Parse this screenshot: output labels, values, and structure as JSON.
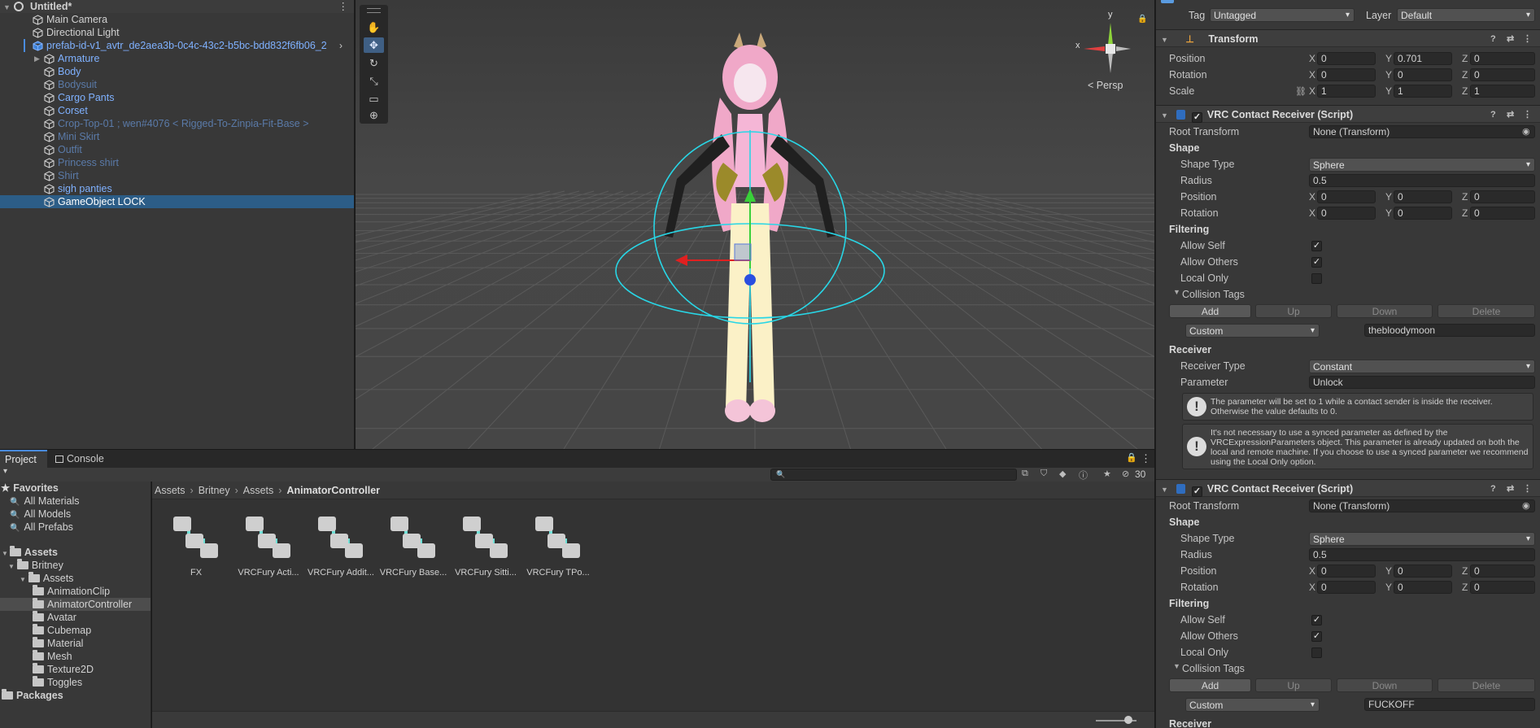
{
  "hierarchy": {
    "scene_name": "Untitled*",
    "items": [
      {
        "label": "Main Camera",
        "style": "normal"
      },
      {
        "label": "Directional Light",
        "style": "normal"
      },
      {
        "label": "prefab-id-v1_avtr_de2aea3b-0c4c-43c2-b5bc-bdd832f6fb06_2",
        "style": "prefab"
      },
      {
        "label": "Armature",
        "style": "blue"
      },
      {
        "label": "Body",
        "style": "blue"
      },
      {
        "label": "Bodysuit",
        "style": "dim"
      },
      {
        "label": "Cargo Pants",
        "style": "blue"
      },
      {
        "label": "Corset",
        "style": "blue"
      },
      {
        "label": "Crop-Top-01 ; wen#4076 < Rigged-To-Zinpia-Fit-Base >",
        "style": "dim"
      },
      {
        "label": "Mini Skirt",
        "style": "dim"
      },
      {
        "label": "Outfit",
        "style": "dim"
      },
      {
        "label": "Princess shirt",
        "style": "dim"
      },
      {
        "label": "Shirt",
        "style": "dim"
      },
      {
        "label": "sigh panties",
        "style": "blue"
      },
      {
        "label": "GameObject LOCK",
        "style": "selected"
      }
    ]
  },
  "scene": {
    "persp_label": "< Persp",
    "gizmo_x": "x",
    "gizmo_y": "y",
    "tools": [
      "hand-tool",
      "move-tool",
      "rotate-tool",
      "scale-tool",
      "rect-tool",
      "transform-tool"
    ]
  },
  "project": {
    "tabs": [
      "Project",
      "Console"
    ],
    "hidden_count": "30",
    "favorites": {
      "title": "Favorites",
      "items": [
        "All Materials",
        "All Models",
        "All Prefabs"
      ]
    },
    "tree": [
      {
        "label": "Assets",
        "depth": 0,
        "bold": true
      },
      {
        "label": "Britney",
        "depth": 1
      },
      {
        "label": "Assets",
        "depth": 2
      },
      {
        "label": "AnimationClip",
        "depth": 3
      },
      {
        "label": "AnimatorController",
        "depth": 3,
        "selected": true
      },
      {
        "label": "Avatar",
        "depth": 3
      },
      {
        "label": "Cubemap",
        "depth": 3
      },
      {
        "label": "Material",
        "depth": 3
      },
      {
        "label": "Mesh",
        "depth": 3
      },
      {
        "label": "Texture2D",
        "depth": 3
      },
      {
        "label": "Toggles",
        "depth": 3
      },
      {
        "label": "Packages",
        "depth": 0,
        "bold": true
      }
    ],
    "breadcrumb": [
      "Assets",
      "Britney",
      "Assets",
      "AnimatorController"
    ],
    "assets": [
      "FX",
      "VRCFury Acti...",
      "VRCFury Addit...",
      "VRCFury Base...",
      "VRCFury Sitti...",
      "VRCFury TPo..."
    ]
  },
  "inspector": {
    "tag_label": "Tag",
    "tag_value": "Untagged",
    "layer_label": "Layer",
    "layer_value": "Default",
    "transform": {
      "title": "Transform",
      "position_label": "Position",
      "position": [
        "0",
        "0.701",
        "0"
      ],
      "rotation_label": "Rotation",
      "rotation": [
        "0",
        "0",
        "0"
      ],
      "scale_label": "Scale",
      "scale": [
        "1",
        "1",
        "1"
      ]
    },
    "receivers": [
      {
        "title": "VRC Contact Receiver (Script)",
        "root_transform_label": "Root Transform",
        "root_transform": "None (Transform)",
        "shape_label": "Shape",
        "shape_type_label": "Shape Type",
        "shape_type": "Sphere",
        "radius_label": "Radius",
        "radius": "0.5",
        "position_label": "Position",
        "position": [
          "0",
          "0",
          "0"
        ],
        "rotation_label": "Rotation",
        "rotation": [
          "0",
          "0",
          "0"
        ],
        "filtering_label": "Filtering",
        "allow_self_label": "Allow Self",
        "allow_self": true,
        "allow_others_label": "Allow Others",
        "allow_others": true,
        "local_only_label": "Local Only",
        "local_only": false,
        "collision_tags_label": "Collision Tags",
        "buttons": [
          "Add",
          "Up",
          "Down",
          "Delete"
        ],
        "tag_mode": "Custom",
        "tag_value": "thebloodymoon",
        "receiver_label": "Receiver",
        "receiver_type_label": "Receiver Type",
        "receiver_type": "Constant",
        "parameter_label": "Parameter",
        "parameter": "Unlock",
        "help1": "The parameter will be set to 1 while a contact sender is inside the receiver. Otherwise the value defaults to 0.",
        "help2": "It's not necessary to use a synced parameter as defined by the VRCExpressionParameters object.  This parameter is already updated on both the local and remote machine.  If you choose to use a synced parameter we recommend using the Local Only option."
      },
      {
        "title": "VRC Contact Receiver (Script)",
        "root_transform_label": "Root Transform",
        "root_transform": "None (Transform)",
        "shape_label": "Shape",
        "shape_type_label": "Shape Type",
        "shape_type": "Sphere",
        "radius_label": "Radius",
        "radius": "0.5",
        "position_label": "Position",
        "position": [
          "0",
          "0",
          "0"
        ],
        "rotation_label": "Rotation",
        "rotation": [
          "0",
          "0",
          "0"
        ],
        "filtering_label": "Filtering",
        "allow_self_label": "Allow Self",
        "allow_self": true,
        "allow_others_label": "Allow Others",
        "allow_others": true,
        "local_only_label": "Local Only",
        "local_only": false,
        "collision_tags_label": "Collision Tags",
        "buttons": [
          "Add",
          "Up",
          "Down",
          "Delete"
        ],
        "tag_mode": "Custom",
        "tag_value": "FUCKOFF",
        "receiver_label": "Receiver"
      }
    ]
  },
  "colors": {
    "accent": "#2c5d87",
    "prefab_blue": "#7fb1ff",
    "gizmo_cyan": "#28d6e6"
  }
}
